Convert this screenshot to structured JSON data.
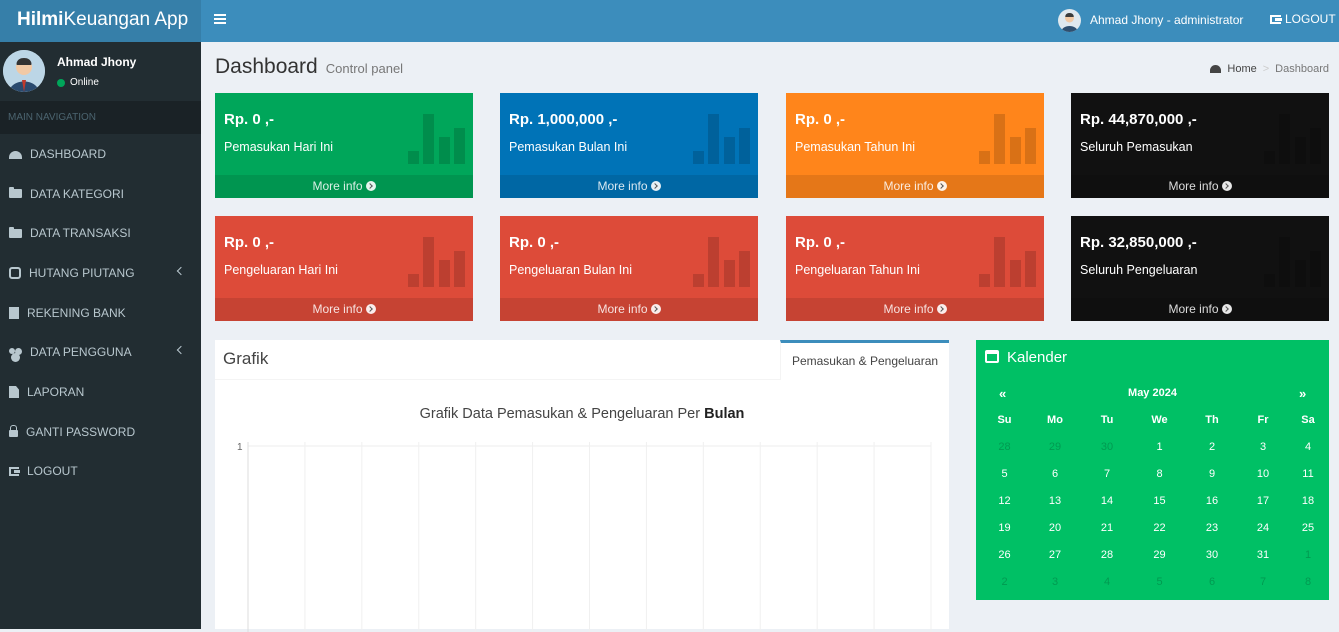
{
  "app": {
    "title_bold": "Hilmi",
    "title_rest": "Keuangan App"
  },
  "navbar": {
    "user_label": "Ahmad Jhony - administrator",
    "logout_label": "LOGOUT"
  },
  "sidebar": {
    "user_name": "Ahmad Jhony",
    "user_status": "Online",
    "nav_header": "MAIN NAVIGATION",
    "items": [
      {
        "label": "DASHBOARD",
        "icon": "dashboard-icon"
      },
      {
        "label": "DATA KATEGORI",
        "icon": "folder-icon"
      },
      {
        "label": "DATA TRANSAKSI",
        "icon": "folder-icon"
      },
      {
        "label": "HUTANG PIUTANG",
        "icon": "hand-icon"
      },
      {
        "label": "REKENING BANK",
        "icon": "bank-icon"
      },
      {
        "label": "DATA PENGGUNA",
        "icon": "users-icon"
      },
      {
        "label": "LAPORAN",
        "icon": "file-icon"
      },
      {
        "label": "GANTI PASSWORD",
        "icon": "lock-icon"
      },
      {
        "label": "LOGOUT",
        "icon": "logout-icon"
      }
    ]
  },
  "header": {
    "title": "Dashboard",
    "subtitle": "Control panel"
  },
  "breadcrumb": {
    "home": "Home",
    "current": "Dashboard",
    "separator": ">"
  },
  "boxes": [
    {
      "amount": "Rp. 0 ,-",
      "label": "Pemasukan Hari Ini",
      "more": "More info",
      "color": "#00a65a"
    },
    {
      "amount": "Rp. 1,000,000 ,-",
      "label": "Pemasukan Bulan Ini",
      "more": "More info",
      "color": "#0073b7"
    },
    {
      "amount": "Rp. 0 ,-",
      "label": "Pemasukan Tahun Ini",
      "more": "More info",
      "color": "#ff851b"
    },
    {
      "amount": "Rp. 44,870,000 ,-",
      "label": "Seluruh Pemasukan",
      "more": "More info",
      "color": "#111111"
    },
    {
      "amount": "Rp. 0 ,-",
      "label": "Pengeluaran Hari Ini",
      "more": "More info",
      "color": "#dd4b39"
    },
    {
      "amount": "Rp. 0 ,-",
      "label": "Pengeluaran Bulan Ini",
      "more": "More info",
      "color": "#dd4b39"
    },
    {
      "amount": "Rp. 0 ,-",
      "label": "Pengeluaran Tahun Ini",
      "more": "More info",
      "color": "#dd4b39"
    },
    {
      "amount": "Rp. 32,850,000 ,-",
      "label": "Seluruh Pengeluaran",
      "more": "More info",
      "color": "#111111"
    }
  ],
  "grafik": {
    "title": "Grafik",
    "tab_label": "Pemasukan & Pengeluaran",
    "chart_title_normal": "Grafik Data Pemasukan & Pengeluaran Per",
    "chart_title_bold": "Bulan"
  },
  "chart_data": {
    "type": "bar",
    "title": "Grafik Data Pemasukan & Pengeluaran Per Bulan",
    "y_tick_labels": [
      "1"
    ],
    "ylim": [
      0,
      1
    ],
    "grid": true,
    "series": []
  },
  "calendar": {
    "title": "Kalender",
    "month": "May 2024",
    "prev": "«",
    "next": "»",
    "days": [
      "Su",
      "Mo",
      "Tu",
      "We",
      "Th",
      "Fr",
      "Sa"
    ],
    "weeks": [
      [
        {
          "d": "28",
          "o": true
        },
        {
          "d": "29",
          "o": true
        },
        {
          "d": "30",
          "o": true
        },
        {
          "d": "1"
        },
        {
          "d": "2"
        },
        {
          "d": "3"
        },
        {
          "d": "4"
        }
      ],
      [
        {
          "d": "5"
        },
        {
          "d": "6"
        },
        {
          "d": "7"
        },
        {
          "d": "8"
        },
        {
          "d": "9"
        },
        {
          "d": "10"
        },
        {
          "d": "11"
        }
      ],
      [
        {
          "d": "12"
        },
        {
          "d": "13"
        },
        {
          "d": "14"
        },
        {
          "d": "15"
        },
        {
          "d": "16"
        },
        {
          "d": "17"
        },
        {
          "d": "18"
        }
      ],
      [
        {
          "d": "19"
        },
        {
          "d": "20"
        },
        {
          "d": "21"
        },
        {
          "d": "22"
        },
        {
          "d": "23"
        },
        {
          "d": "24"
        },
        {
          "d": "25"
        }
      ],
      [
        {
          "d": "26"
        },
        {
          "d": "27"
        },
        {
          "d": "28"
        },
        {
          "d": "29"
        },
        {
          "d": "30"
        },
        {
          "d": "31"
        },
        {
          "d": "1",
          "o": true
        }
      ],
      [
        {
          "d": "2",
          "o": true
        },
        {
          "d": "3",
          "o": true
        },
        {
          "d": "4",
          "o": true
        },
        {
          "d": "5",
          "o": true
        },
        {
          "d": "6",
          "o": true
        },
        {
          "d": "7",
          "o": true
        },
        {
          "d": "8",
          "o": true
        }
      ]
    ]
  }
}
